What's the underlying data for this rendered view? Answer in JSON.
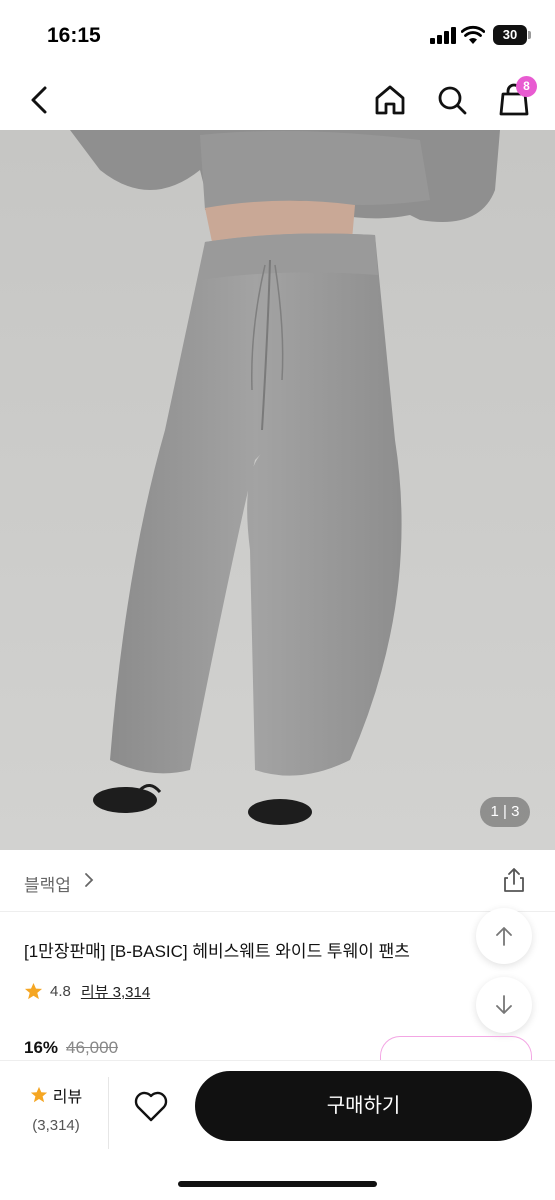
{
  "status_bar": {
    "time": "16:15",
    "battery": "30"
  },
  "nav": {
    "cart_count": "8"
  },
  "hero": {
    "pager": "1 | 3"
  },
  "brand": {
    "name": "블랙업",
    "chevron": ">"
  },
  "product": {
    "title": "[1만장판매] [B-BASIC] 헤비스웨트 와이드 투웨이 팬츠",
    "rating": "4.8",
    "review_link": "리뷰 3,314",
    "discount": "16%",
    "original_price": "46,000"
  },
  "bottom_bar": {
    "review_label": "리뷰",
    "review_count": "(3,314)",
    "buy_label": "구매하기"
  },
  "colors": {
    "accent_pink": "#e85bd1",
    "star": "#f5a623",
    "button": "#111111"
  }
}
